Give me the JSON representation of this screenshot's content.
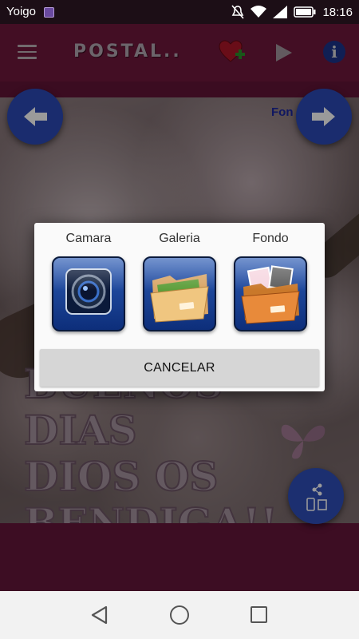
{
  "status_bar": {
    "carrier": "Yoigo",
    "time": "18:16",
    "icons": [
      "image-notification-icon",
      "mute-icon",
      "wifi-icon",
      "signal-icon",
      "battery-icon"
    ]
  },
  "app_bar": {
    "title": "POSTAL..",
    "menu_icon": "hamburger-menu-icon",
    "actions": [
      "favorite-add-icon",
      "play-icon",
      "info-icon"
    ],
    "info_glyph": "i"
  },
  "canvas": {
    "overlay_label": "Fon",
    "photo_text_lines": [
      "BUENOS DIAS",
      "DIOS OS",
      "BENDIGA!!"
    ]
  },
  "dialog": {
    "options": [
      {
        "label": "Camara",
        "icon": "camera-icon"
      },
      {
        "label": "Galeria",
        "icon": "gallery-folder-icon"
      },
      {
        "label": "Fondo",
        "icon": "background-folder-icon"
      }
    ],
    "cancel_label": "CANCELAR"
  },
  "colors": {
    "app_bar": "#7a1a43",
    "fab": "#243e9c",
    "dialog_bg": "#fafafa",
    "cancel_bg": "#d6d6d6"
  }
}
